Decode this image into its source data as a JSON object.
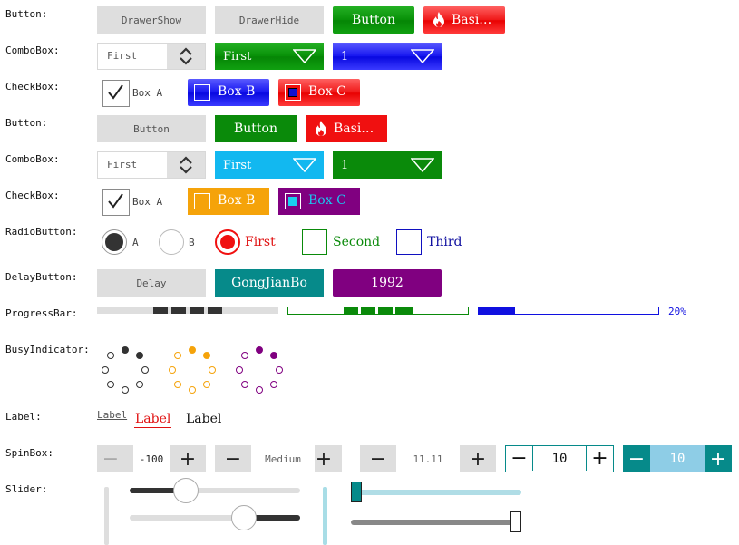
{
  "rows": {
    "button1": "Button:",
    "combobox1": "ComboBox:",
    "checkbox1": "CheckBox:",
    "button2": "Button:",
    "combobox2": "ComboBox:",
    "checkbox2": "CheckBox:",
    "radiobutton": "RadioButton:",
    "delaybutton": "DelayButton:",
    "progressbar": "ProgressBar:",
    "busyindicator": "BusyIndicator:",
    "label": "Label:",
    "spinbox": "SpinBox:",
    "slider": "Slider:"
  },
  "buttons1": {
    "drawer_show": "DrawerShow",
    "drawer_hide": "DrawerHide",
    "button": "Button",
    "basic": "Basi…"
  },
  "combos1": {
    "first": "First",
    "first_green": "First",
    "one_blue": "1"
  },
  "checks1": {
    "a": "Box A",
    "b": "Box B",
    "c": "Box C"
  },
  "buttons2": {
    "button_gray": "Button",
    "button_green": "Button",
    "basic": "Basi…"
  },
  "combos2": {
    "first": "First",
    "first_sky": "First",
    "one_green": "1"
  },
  "checks2": {
    "a": "Box A",
    "b": "Box B",
    "c": "Box C"
  },
  "radios": {
    "a": "A",
    "b": "B",
    "first": "First",
    "second": "Second",
    "third": "Third"
  },
  "delay": {
    "delay": "Delay",
    "name": "GongJianBo",
    "year": "1992"
  },
  "progress": {
    "percent_label": "20%",
    "value": 0.2
  },
  "labels": {
    "l1": "Label",
    "l2": "Label",
    "l3": "Label"
  },
  "spin": {
    "v1": "-100",
    "v2": "Medium",
    "v3": "11.11",
    "v4": "10",
    "v5": "10"
  },
  "colors": {
    "green": "#0a8a0a",
    "red": "#f01010",
    "blue": "#1010f0",
    "sky": "#12b8f0",
    "teal": "#068a8a",
    "purple": "#800080",
    "orange": "#f5a30a"
  },
  "icons": {
    "fire": "fire-icon",
    "dropdown": "triangle-down-icon",
    "updown": "chevron-updown-icon"
  }
}
